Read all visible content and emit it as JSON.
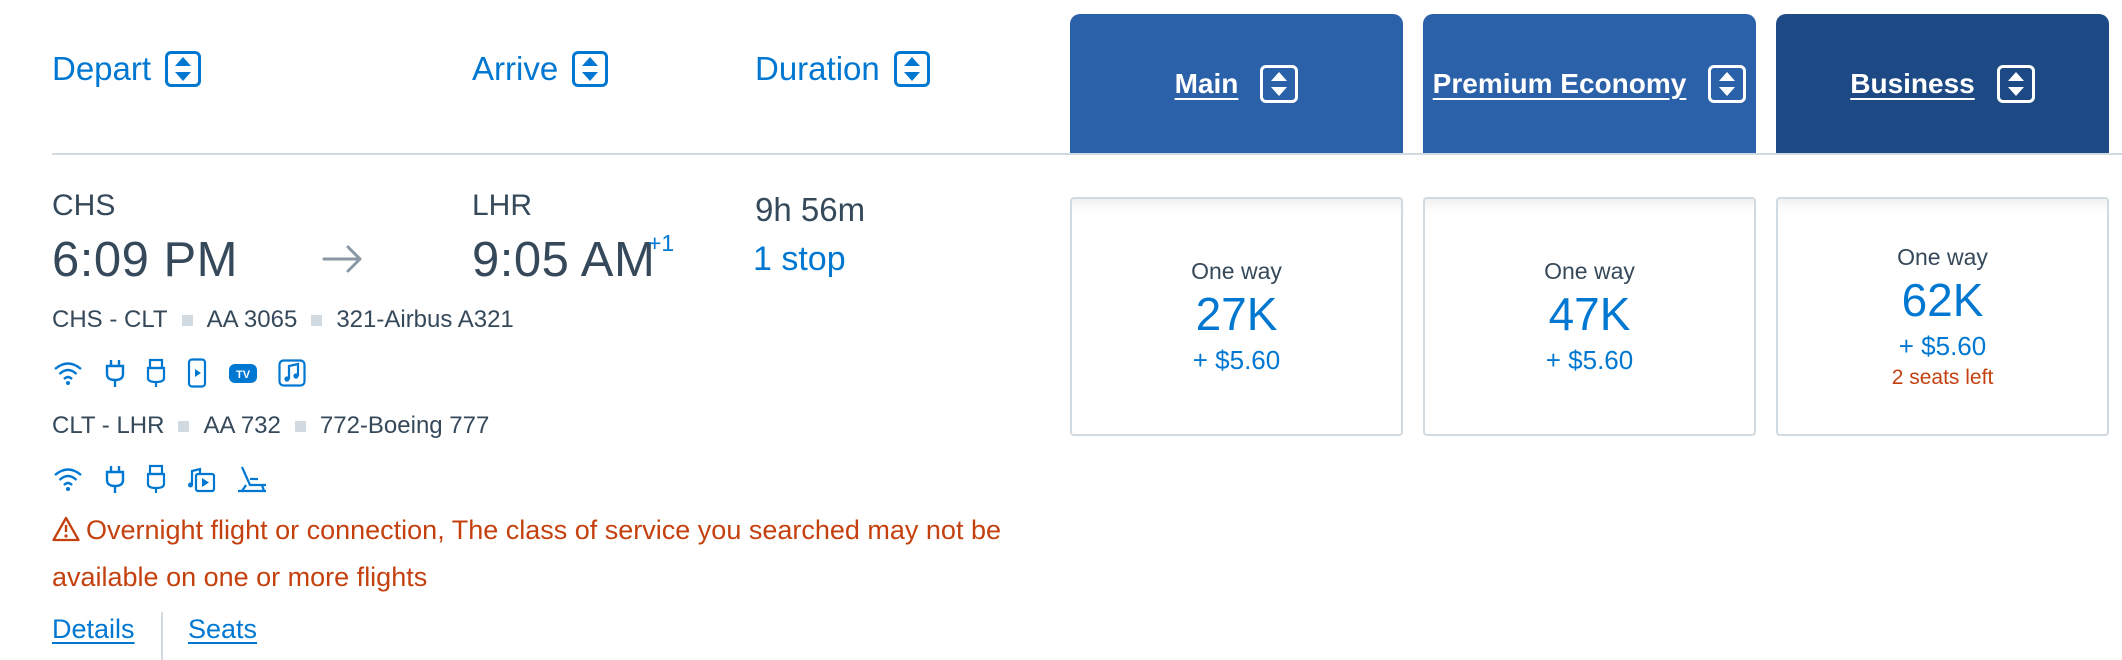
{
  "headers": {
    "depart": "Depart",
    "arrive": "Arrive",
    "duration": "Duration"
  },
  "cabins": [
    {
      "label": "Main",
      "color": "#2b61a8"
    },
    {
      "label": "Premium Economy",
      "color": "#2b61a8"
    },
    {
      "label": "Business",
      "color": "#1d4a84"
    }
  ],
  "flight": {
    "origin": "CHS",
    "depart_time": "6:09 PM",
    "destination": "LHR",
    "arrive_time": "9:05 AM",
    "day_offset": "+1",
    "duration": "9h 56m",
    "stops": "1 stop",
    "segments": [
      {
        "route": "CHS - CLT",
        "flight_number": "AA 3065",
        "aircraft": "321-Airbus A321",
        "amenities": [
          "wifi-icon",
          "power-outlet-icon",
          "usb-icon",
          "entertainment-device-icon",
          "live-tv-icon",
          "music-icon"
        ]
      },
      {
        "route": "CLT - LHR",
        "flight_number": "AA 732",
        "aircraft": "772-Boeing 777",
        "amenities": [
          "wifi-icon",
          "power-outlet-icon",
          "usb-icon",
          "on-demand-entertainment-icon",
          "lie-flat-seat-icon"
        ]
      }
    ],
    "warning": "Overnight flight or connection, The class of service you searched may not be available on one or more flights",
    "tv_badge": "TV"
  },
  "fares": [
    {
      "label": "One way",
      "miles": "27K",
      "taxes": "+ $5.60"
    },
    {
      "label": "One way",
      "miles": "47K",
      "taxes": "+ $5.60"
    },
    {
      "label": "One way",
      "miles": "62K",
      "taxes": "+ $5.60",
      "seats_left": "2 seats left"
    }
  ],
  "links": {
    "details": "Details",
    "seats": "Seats"
  },
  "colors": {
    "accent": "#0078d2",
    "warning": "#c4410f",
    "tab_main": "#2b61a8",
    "tab_business": "#1d4a84"
  }
}
